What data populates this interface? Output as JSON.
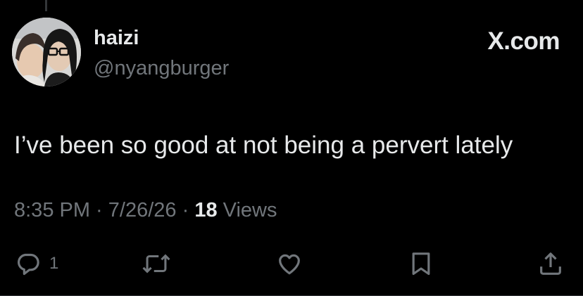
{
  "author": {
    "display_name": "haizi",
    "handle": "@nyangburger"
  },
  "brand": {
    "label": "X.com"
  },
  "tweet": {
    "text": "I’ve been so good at not being a pervert lately"
  },
  "meta": {
    "time": "8:35 PM",
    "sep1": " · ",
    "date": "7/26/26",
    "sep2": " · ",
    "views_count": "18",
    "views_label": " Views"
  },
  "actions": {
    "reply_count": "1",
    "icons": [
      "reply-icon",
      "repost-icon",
      "like-icon",
      "bookmark-icon",
      "share-icon"
    ]
  },
  "colors": {
    "background": "#000000",
    "primary_text": "#e7e9ea",
    "secondary_text": "#71767b"
  }
}
